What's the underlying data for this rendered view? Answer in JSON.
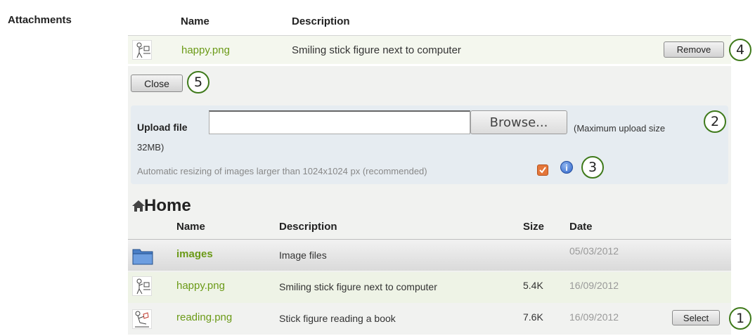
{
  "attachments": {
    "section_label": "Attachments",
    "headers": {
      "name": "Name",
      "description": "Description"
    },
    "row": {
      "filename": "happy.png",
      "description": "Smiling stick figure next to computer",
      "remove_label": "Remove"
    },
    "close_label": "Close"
  },
  "upload": {
    "label": "Upload file",
    "browse_label": "Browse...",
    "max_size_line1": "(Maximum upload size",
    "max_size_line2": "32MB)",
    "resize_text": "Automatic resizing of images larger than 1024x1024 px (recommended)",
    "resize_checked": true,
    "info_glyph": "i"
  },
  "home": {
    "title": "Home",
    "headers": {
      "name": "Name",
      "description": "Description",
      "size": "Size",
      "date": "Date"
    },
    "rows": [
      {
        "icon": "folder-icon",
        "name": "images",
        "description": "Image files",
        "size": "",
        "date": "05/03/2012",
        "bold": true
      },
      {
        "icon": "image-thumbnail-icon",
        "name": "happy.png",
        "description": "Smiling stick figure next to computer",
        "size": "5.4K",
        "date": "16/09/2012"
      },
      {
        "icon": "image-thumbnail-icon",
        "name": "reading.png",
        "description": "Stick figure reading a book",
        "size": "7.6K",
        "date": "16/09/2012",
        "select_label": "Select"
      }
    ]
  },
  "callouts": [
    "1",
    "2",
    "3",
    "4",
    "5"
  ],
  "colors": {
    "link_green": "#6b9a17",
    "panel": "#f1f2f0",
    "upload_box": "#e6ecf1",
    "row_alt": "#f4f7ee",
    "folder_row": "#e4e4e4",
    "checkbox": "#e4763a",
    "callout_border": "#3f7a1b"
  }
}
